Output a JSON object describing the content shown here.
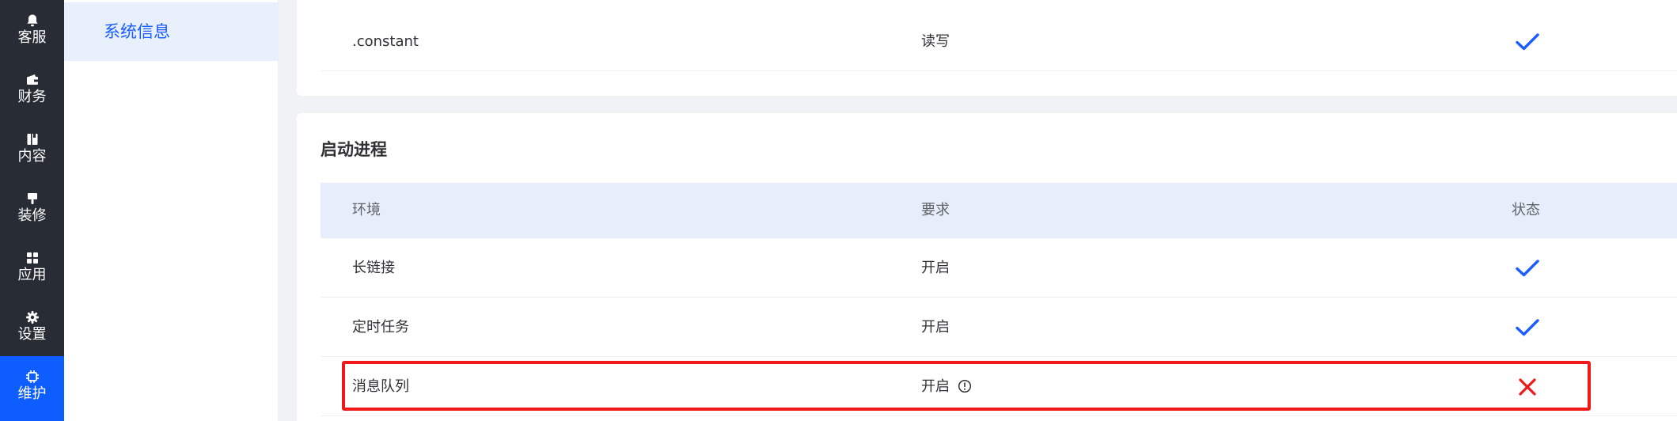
{
  "sidebar": {
    "items": [
      {
        "label": "客服",
        "icon": "bell-icon"
      },
      {
        "label": "财务",
        "icon": "wallet-icon"
      },
      {
        "label": "内容",
        "icon": "book-icon"
      },
      {
        "label": "装修",
        "icon": "brush-icon"
      },
      {
        "label": "应用",
        "icon": "apps-grid-icon"
      },
      {
        "label": "设置",
        "icon": "gear-icon"
      },
      {
        "label": "维护",
        "icon": "chip-icon",
        "active": true
      }
    ]
  },
  "submenu": {
    "active_label": "系统信息"
  },
  "dir_permissions": {
    "rows": [
      {
        "name": ".constant",
        "requirement": "读写",
        "status": "ok"
      }
    ]
  },
  "process": {
    "title": "启动进程",
    "columns": [
      "环境",
      "要求",
      "状态"
    ],
    "rows": [
      {
        "name": "长链接",
        "requirement": "开启",
        "status": "ok"
      },
      {
        "name": "定时任务",
        "requirement": "开启",
        "status": "ok"
      },
      {
        "name": "消息队列",
        "requirement": "开启",
        "status": "fail",
        "has_warning": true
      }
    ]
  },
  "colors": {
    "accent": "#0e5eff",
    "ok": "#1a5cff",
    "fail": "#f01818",
    "rail_bg": "#282c35"
  }
}
